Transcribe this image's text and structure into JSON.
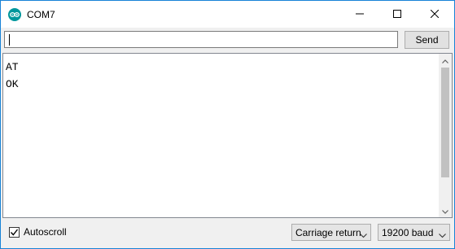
{
  "window": {
    "title": "COM7",
    "app_icon": "arduino-logo-icon",
    "controls": [
      "minimize-icon",
      "maximize-icon",
      "close-icon"
    ]
  },
  "input": {
    "value": "",
    "placeholder": ""
  },
  "toolbar": {
    "send_label": "Send"
  },
  "output": {
    "lines": [
      "AT",
      "OK"
    ]
  },
  "footer": {
    "autoscroll_label": "Autoscroll",
    "autoscroll_checked": true,
    "line_ending": "Carriage return",
    "baud_rate": "19200 baud"
  },
  "colors": {
    "accent_border": "#1883d7",
    "arduino_teal": "#00979c"
  }
}
